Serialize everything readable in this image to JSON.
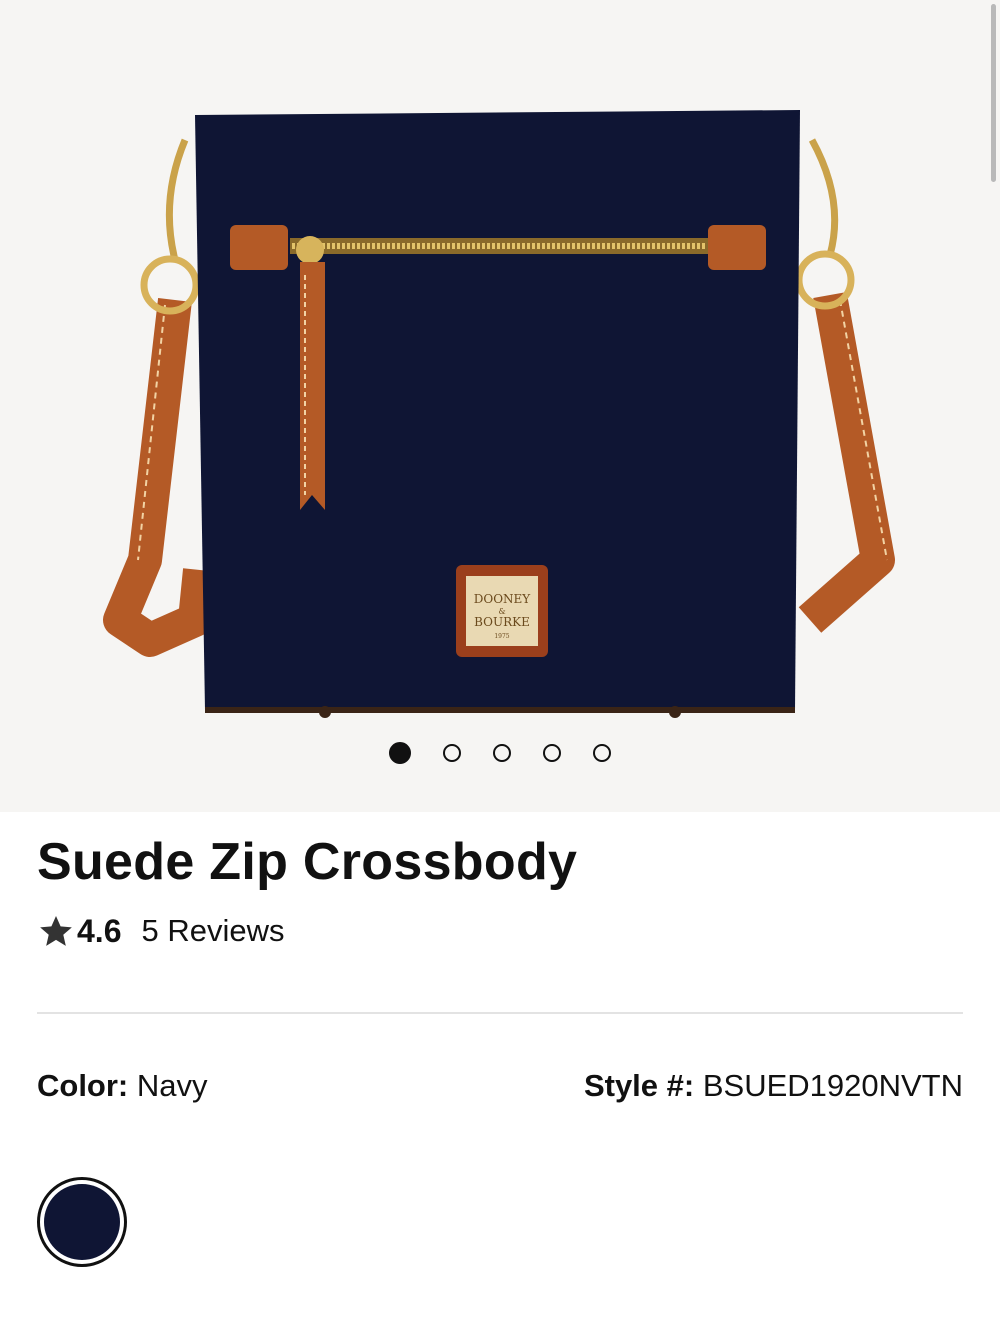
{
  "product": {
    "image_alt": "Navy suede crossbody bag with tan leather strap",
    "brand_tag_line1": "DOONEY",
    "brand_tag_line2": "&",
    "brand_tag_line3": "BOURKE",
    "brand_tag_year": "1975",
    "title": "Suede Zip Crossbody",
    "rating": "4.6",
    "reviews_label": "5 Reviews",
    "color_label": "Color:",
    "color_value": "Navy",
    "style_label": "Style #:",
    "style_value": "BSUED1920NVTN"
  },
  "carousel": {
    "total": 5,
    "active_index": 0
  },
  "colors": {
    "navy": "#0f1534",
    "leather": "#b45a26",
    "accent": "#111111"
  },
  "icons": {
    "star": "star-icon"
  }
}
